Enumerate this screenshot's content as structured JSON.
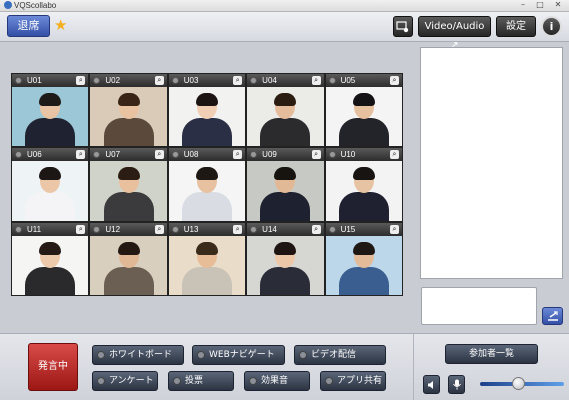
{
  "window": {
    "title": "VQScollabo",
    "min": "–",
    "max": "□",
    "close": "✕"
  },
  "toolbar": {
    "exit_label": "退席",
    "favorite_icon": "star-icon",
    "camera_icon": "camera-view-icon",
    "video_audio_label": "Video/Audio ↗",
    "settings_label": "設定",
    "info_label": "i"
  },
  "participants": [
    {
      "label": "U01",
      "bg": "#9cc7d6",
      "skin": "#e8c4a4",
      "hair": "#1e1a18",
      "cloth": "#1f2230"
    },
    {
      "label": "U02",
      "bg": "#d9cbb7",
      "skin": "#e9c2a2",
      "hair": "#3a2417",
      "cloth": "#5b4a3c"
    },
    {
      "label": "U03",
      "bg": "#f2f2f0",
      "skin": "#f0cfb4",
      "hair": "#1b1412",
      "cloth": "#2a2f45"
    },
    {
      "label": "U04",
      "bg": "#ebebe8",
      "skin": "#e5bd9c",
      "hair": "#2b1c12",
      "cloth": "#2b2b2e"
    },
    {
      "label": "U05",
      "bg": "#f4f4f4",
      "skin": "#e6c1a0",
      "hair": "#141214",
      "cloth": "#222429"
    },
    {
      "label": "U06",
      "bg": "#eef3f5",
      "skin": "#ecc7a7",
      "hair": "#1c1614",
      "cloth": "#f4f4f6"
    },
    {
      "label": "U07",
      "bg": "#cfd3c9",
      "skin": "#e8c09e",
      "hair": "#2b1d13",
      "cloth": "#3b3b3d"
    },
    {
      "label": "U08",
      "bg": "#f5f5f5",
      "skin": "#e7c1a0",
      "hair": "#1d1814",
      "cloth": "#d9dde3"
    },
    {
      "label": "U09",
      "bg": "#c7c9c4",
      "skin": "#e2b996",
      "hair": "#17130f",
      "cloth": "#1e2130"
    },
    {
      "label": "U10",
      "bg": "#f3f3f3",
      "skin": "#e7c3a3",
      "hair": "#181412",
      "cloth": "#1f2130"
    },
    {
      "label": "U11",
      "bg": "#f5f5f3",
      "skin": "#ecc9aa",
      "hair": "#241915",
      "cloth": "#2a2a2c"
    },
    {
      "label": "U12",
      "bg": "#d9cfbe",
      "skin": "#e0b896",
      "hair": "#241812",
      "cloth": "#6a5f52"
    },
    {
      "label": "U13",
      "bg": "#e9ddc9",
      "skin": "#e6bd97",
      "hair": "#3a2a1a",
      "cloth": "#c9c2b6"
    },
    {
      "label": "U14",
      "bg": "#d6d6d2",
      "skin": "#ecc8a8",
      "hair": "#1e1512",
      "cloth": "#2a2c38"
    },
    {
      "label": "U15",
      "bg": "#bcd7ea",
      "skin": "#e4bb98",
      "hair": "#1e1714",
      "cloth": "#3a5e8f"
    }
  ],
  "chat": {
    "send_icon": "send-icon"
  },
  "bottom": {
    "speaking_label": "発言中",
    "whiteboard": "ホワイトボード",
    "web_navigate": "WEBナビゲート",
    "video_stream": "ビデオ配信",
    "survey": "アンケート",
    "vote": "投票",
    "sound_effects": "効果音",
    "app_share": "アプリ共有",
    "participants_list": "参加者一覧",
    "speaker_icon": "speaker-icon",
    "mic_icon": "microphone-icon",
    "volume_level": 0.45
  }
}
